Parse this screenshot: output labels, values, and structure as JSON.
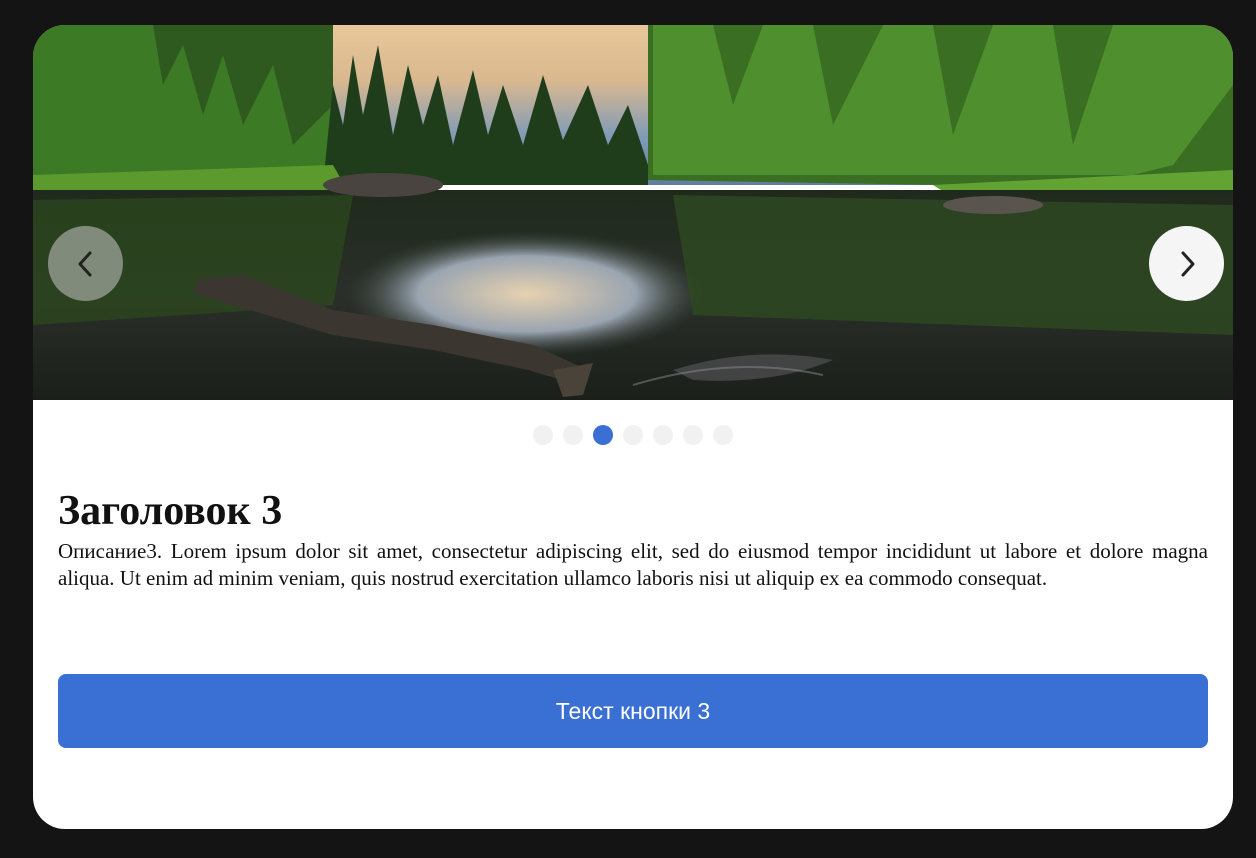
{
  "slider": {
    "image_alt": "forest-lake-reflection",
    "prev_icon": "chevron-left-icon",
    "next_icon": "chevron-right-icon",
    "dot_count": 7,
    "active_slide": 3
  },
  "slide": {
    "title": "Заголовок 3",
    "description": "Описание3. Lorem ipsum dolor sit amet, consectetur adipiscing elit, sed do eiusmod tempor incididunt ut labore et dolore magna aliqua. Ut enim ad minim veniam, quis nostrud exercitation ullamco laboris nisi ut aliquip ex ea commodo consequat.",
    "button_label": "Текст кнопки 3"
  },
  "colors": {
    "accent": "#3a6fd4",
    "dot_inactive": "#f1f1f1",
    "card_bg": "#ffffff",
    "page_bg": "#141414"
  }
}
